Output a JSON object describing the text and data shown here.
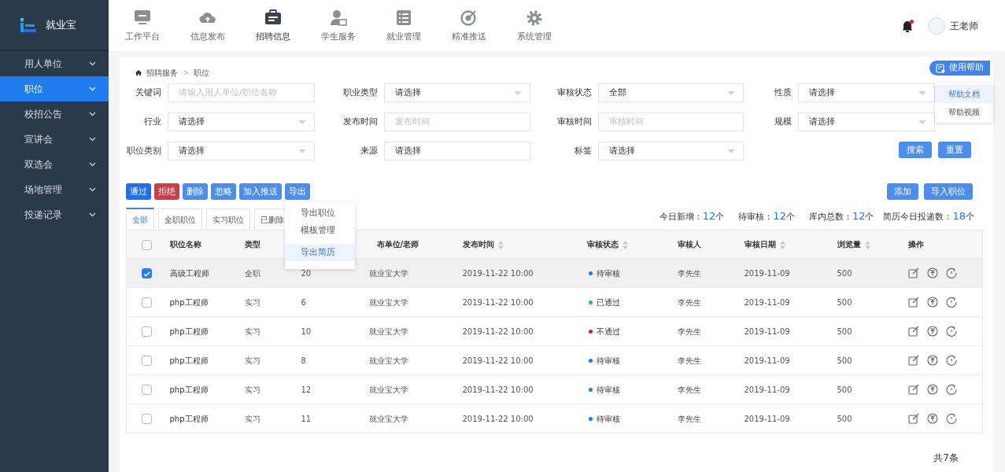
{
  "app": {
    "logo_text": "就业宝"
  },
  "topnav": [
    {
      "label": "工作平台",
      "selected": false
    },
    {
      "label": "信息发布",
      "selected": false
    },
    {
      "label": "招聘信息",
      "selected": true
    },
    {
      "label": "学生服务",
      "selected": false
    },
    {
      "label": "就业管理",
      "selected": false
    },
    {
      "label": "精准推送",
      "selected": false
    },
    {
      "label": "系统管理",
      "selected": false
    }
  ],
  "notification": {
    "unread": true
  },
  "user": {
    "name": "王老师"
  },
  "sidebar": {
    "items": [
      {
        "label": "用人单位",
        "selected": false
      },
      {
        "label": "职位",
        "selected": true
      },
      {
        "label": "校招公告",
        "selected": false
      },
      {
        "label": "宣讲会",
        "selected": false
      },
      {
        "label": "双选会",
        "selected": false
      },
      {
        "label": "场地管理",
        "selected": false
      },
      {
        "label": "投递记录",
        "selected": false
      }
    ]
  },
  "breadcrumb": {
    "items": [
      "招聘服务",
      "职位"
    ],
    "separator": ">"
  },
  "help": {
    "label": "使用帮助",
    "menu": [
      {
        "label": "帮助文档",
        "selected": true
      },
      {
        "label": "帮助视频",
        "selected": false
      }
    ]
  },
  "filters": [
    {
      "label": "关键词",
      "kind": "text",
      "placeholder": "请输入用人单位/职位名称"
    },
    {
      "label": "职业类型",
      "kind": "select",
      "value": "请选择"
    },
    {
      "label": "审核状态",
      "kind": "select",
      "value": "全部"
    },
    {
      "label": "性质",
      "kind": "select",
      "value": "请选择"
    },
    {
      "label": "行业",
      "kind": "select",
      "value": "请选择"
    },
    {
      "label": "发布时间",
      "kind": "text",
      "placeholder": "发布时间"
    },
    {
      "label": "审核时间",
      "kind": "text",
      "placeholder": "审核时间"
    },
    {
      "label": "规模",
      "kind": "select",
      "value": "请选择"
    },
    {
      "label": "职位类别",
      "kind": "select",
      "value": "请选择"
    },
    {
      "label": "来源",
      "kind": "text",
      "value": "请选择"
    },
    {
      "label": "标签",
      "kind": "select",
      "value": "请选择"
    }
  ],
  "filter_buttons": [
    "搜索",
    "重置"
  ],
  "actions": [
    {
      "label": "通过",
      "kind": "primary"
    },
    {
      "label": "拒绝",
      "kind": "danger"
    },
    {
      "label": "删除",
      "kind": "light"
    },
    {
      "label": "忽略",
      "kind": "light"
    },
    {
      "label": "加入推送",
      "kind": "light"
    },
    {
      "label": "导出",
      "kind": "light"
    }
  ],
  "export_menu": [
    {
      "label": "导出职位",
      "selected": false
    },
    {
      "label": "模板管理",
      "selected": false
    },
    {
      "label": "导出简历",
      "selected": true
    }
  ],
  "right_actions": [
    "添加",
    "导入职位"
  ],
  "tabs": [
    {
      "label": "全部",
      "selected": true
    },
    {
      "label": "全职职位",
      "selected": false
    },
    {
      "label": "实习职位",
      "selected": false
    },
    {
      "label": "已删除",
      "selected": false
    }
  ],
  "stats": [
    {
      "label": "今日新增：",
      "value": "12",
      "unit": "个"
    },
    {
      "label": "待审核：",
      "value": "12",
      "unit": "个"
    },
    {
      "label": "库内总数：",
      "value": "12",
      "unit": "个"
    },
    {
      "label": "简历今日投递数：",
      "value": "18",
      "unit": "个"
    }
  ],
  "table": {
    "select_all": {
      "checked": false
    },
    "columns": [
      {
        "label": "职位名称",
        "sortable": false
      },
      {
        "label": "类型",
        "sortable": false
      },
      {},
      {
        "label": "布单位/老师",
        "sortable": false
      },
      {
        "label": "发布时间",
        "sortable": true
      },
      {
        "label": "审核状态",
        "sortable": true
      },
      {
        "label": "审核人",
        "sortable": false
      },
      {
        "label": "审核日期",
        "sortable": true
      },
      {
        "label": "浏览量",
        "sortable": true
      },
      {
        "label": "操作",
        "sortable": false
      }
    ],
    "rows": [
      {
        "selected": true,
        "checked": true,
        "name": "高级工程师",
        "type": "全职",
        "column_3": "20",
        "publisher": "就业宝大学",
        "published": "2019-11-22 10:00",
        "status": {
          "label": "待审核",
          "color": "#1e7bf0"
        },
        "reviewer": "李先生",
        "review_date": "2019-11-09",
        "views": "500"
      },
      {
        "selected": false,
        "checked": false,
        "name": "php工程师",
        "type": "实习",
        "column_3": "6",
        "publisher": "就业宝大学",
        "published": "2019-11-22 10:00",
        "status": {
          "label": "已通过",
          "color": "#19be6b"
        },
        "reviewer": "李先生",
        "review_date": "2019-11-09",
        "views": "500"
      },
      {
        "selected": false,
        "checked": false,
        "name": "php工程师",
        "type": "实习",
        "column_3": "10",
        "publisher": "就业宝大学",
        "published": "2019-11-22 10:00",
        "status": {
          "label": "不通过",
          "color": "#e02020"
        },
        "reviewer": "李先生",
        "review_date": "2019-11-09",
        "views": "500"
      },
      {
        "selected": false,
        "checked": false,
        "name": "php工程师",
        "type": "实习",
        "column_3": "8",
        "publisher": "就业宝大学",
        "published": "2019-11-22 10:00",
        "status": {
          "label": "待审核",
          "color": "#1e7bf0"
        },
        "reviewer": "李先生",
        "review_date": "2019-11-09",
        "views": "500"
      },
      {
        "selected": false,
        "checked": false,
        "name": "php工程师",
        "type": "实习",
        "column_3": "12",
        "publisher": "就业宝大学",
        "published": "2019-11-22 10:00",
        "status": {
          "label": "待审核",
          "color": "#1e7bf0"
        },
        "reviewer": "李先生",
        "review_date": "2019-11-09",
        "views": "500"
      },
      {
        "selected": false,
        "checked": false,
        "name": "php工程师",
        "type": "实习",
        "column_3": "11",
        "publisher": "就业宝大学",
        "published": "2019-11-22 10:00",
        "status": {
          "label": "待审核",
          "color": "#1e7bf0"
        },
        "reviewer": "李先生",
        "review_date": "2019-11-09",
        "views": "500"
      }
    ]
  },
  "footer": {
    "total": "共7条"
  }
}
